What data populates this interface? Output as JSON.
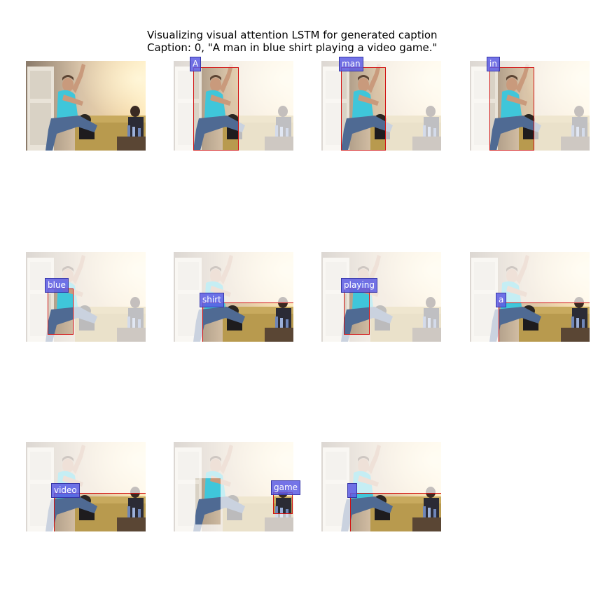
{
  "figure": {
    "title_line1": "Visualizing visual attention LSTM for generated caption",
    "title_line2": "Caption: 0, \"A man in blue shirt playing a video game.\""
  },
  "panels": [
    {
      "label": ""
    },
    {
      "label": "A"
    },
    {
      "label": "man"
    },
    {
      "label": "in"
    },
    {
      "label": "blue"
    },
    {
      "label": "shirt"
    },
    {
      "label": "playing"
    },
    {
      "label": "a"
    },
    {
      "label": "video"
    },
    {
      "label": "game"
    },
    {
      "label": ""
    }
  ],
  "colors": {
    "box_border": "#d11111",
    "label_bg": "#5c5ce4",
    "label_text": "#ffffff"
  }
}
